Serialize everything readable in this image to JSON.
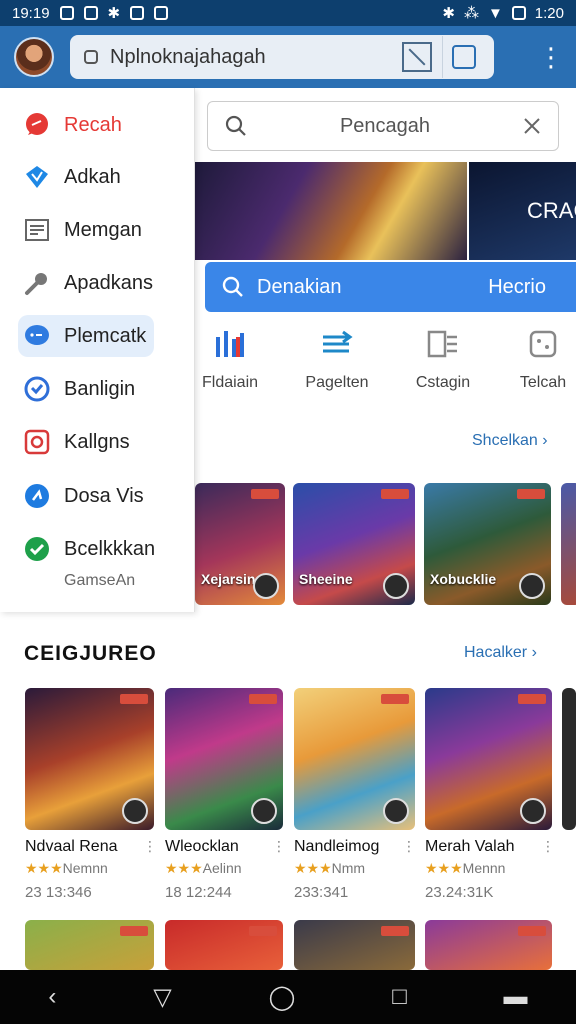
{
  "status": {
    "time": "19:19",
    "right_time": "1:20"
  },
  "browser": {
    "url": "Nplnoknajahagah"
  },
  "drawer": {
    "items": [
      {
        "label": "Recah",
        "icon": "chat-bubble-icon"
      },
      {
        "label": "Adkah",
        "icon": "diamond-icon"
      },
      {
        "label": "Memgan",
        "icon": "list-icon"
      },
      {
        "label": "Apadkans",
        "icon": "wrench-icon"
      },
      {
        "label": "Plemcatk",
        "icon": "message-icon"
      },
      {
        "label": "Banligin",
        "icon": "check-circle-icon"
      },
      {
        "label": "Kallgns",
        "icon": "record-icon"
      },
      {
        "label": "Dosa Vis",
        "icon": "flag-icon"
      },
      {
        "label": "Bcelkkkan",
        "icon": "check-icon"
      }
    ],
    "sub": "GamseAn"
  },
  "search": {
    "text": "Pencagah"
  },
  "banner": {
    "right_text": "CRAC"
  },
  "bluebar": {
    "left": "Denakian",
    "right": "Hecrio"
  },
  "quick": [
    {
      "label": "Fldaiain",
      "icon": "bars-icon"
    },
    {
      "label": "Pagelten",
      "icon": "shuffle-icon"
    },
    {
      "label": "Cstagin",
      "icon": "checklist-icon"
    },
    {
      "label": "Telcah",
      "icon": "dice-icon"
    }
  ],
  "section1": {
    "more": "Shcelkan"
  },
  "row1": [
    "Xejarsin",
    "Sheeine",
    "Xobucklie"
  ],
  "section2": {
    "title": "CEIGJUREO",
    "more": "Hacalker"
  },
  "games": [
    {
      "name": "Ndvaal Rena",
      "rating": "Nemnn",
      "count": "23 13:346"
    },
    {
      "name": "Wleocklan",
      "rating": "Aelinn",
      "count": "18 12:244"
    },
    {
      "name": "Nandleimog",
      "rating": "Nmm",
      "count": "233:341"
    },
    {
      "name": "Merah Valah",
      "rating": "Mennn",
      "count": "23.24:31K"
    }
  ],
  "colors": {
    "topbar": "#2a6fb3",
    "accent": "#3a86e8",
    "statusbar": "#0d3f6e"
  }
}
